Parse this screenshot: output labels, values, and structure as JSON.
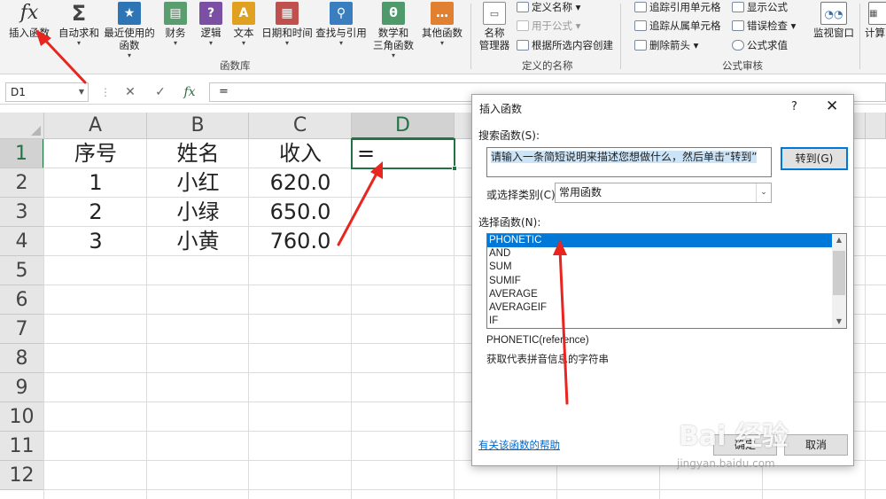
{
  "ribbon": {
    "insert_function": {
      "icon": "fx",
      "label": "插入函数"
    },
    "function_buttons": [
      {
        "id": "autosum",
        "label1": "自动求和",
        "label2": "",
        "icon": "sigma-icon",
        "color": "#555555",
        "glyph": "Σ"
      },
      {
        "id": "recent",
        "label1": "最近使用的",
        "label2": "函数",
        "icon": "star-icon",
        "color": "#2e75b6",
        "glyph": "★"
      },
      {
        "id": "financial",
        "label1": "财务",
        "label2": "",
        "icon": "book-icon",
        "color": "#5a9e6f",
        "glyph": "▤"
      },
      {
        "id": "logical",
        "label1": "逻辑",
        "label2": "",
        "icon": "question-icon",
        "color": "#7b4fa3",
        "glyph": "?"
      },
      {
        "id": "text",
        "label1": "文本",
        "label2": "",
        "icon": "text-a-icon",
        "color": "#e0a020",
        "glyph": "A"
      },
      {
        "id": "datetime",
        "label1": "日期和时间",
        "label2": "",
        "icon": "calendar-icon",
        "color": "#c0504d",
        "glyph": "▦"
      },
      {
        "id": "lookup",
        "label1": "查找与引用",
        "label2": "",
        "icon": "search-book-icon",
        "color": "#3a7ebf",
        "glyph": "⚲"
      },
      {
        "id": "math",
        "label1": "数学和",
        "label2": "三角函数",
        "icon": "theta-icon",
        "color": "#4f9a6a",
        "glyph": "θ"
      },
      {
        "id": "more",
        "label1": "其他函数",
        "label2": "",
        "icon": "more-icon",
        "color": "#e08030",
        "glyph": "…"
      }
    ],
    "group_function_library": "函数库",
    "name_manager": {
      "label1": "名称",
      "label2": "管理器"
    },
    "defined_names": {
      "define": "定义名称",
      "use_in_formula": "用于公式",
      "create_from_selection": "根据所选内容创建"
    },
    "group_defined_names": "定义的名称",
    "auditing": {
      "trace_precedents": "追踪引用单元格",
      "trace_dependents": "追踪从属单元格",
      "remove_arrows": "删除箭头",
      "show_formulas": "显示公式",
      "error_checking": "错误检查",
      "evaluate_formula": "公式求值"
    },
    "group_auditing": "公式审核",
    "watch_window": "监视窗口",
    "calculation": "计算"
  },
  "formula_bar": {
    "name_box": "D1",
    "fx": "fx",
    "formula": "="
  },
  "sheet": {
    "columns": [
      "A",
      "B",
      "C",
      "D"
    ],
    "rows": [
      "1",
      "2",
      "3",
      "4",
      "5",
      "6",
      "7",
      "8",
      "9",
      "10",
      "11",
      "12"
    ],
    "selected_column": "D",
    "selected_row": "1",
    "cells": [
      [
        "序号",
        "姓名",
        "收入",
        "="
      ],
      [
        "1",
        "小红",
        "620.0",
        ""
      ],
      [
        "2",
        "小绿",
        "650.0",
        ""
      ],
      [
        "3",
        "小黄",
        "760.0",
        ""
      ]
    ]
  },
  "dialog": {
    "title": "插入函数",
    "help": "?",
    "close": "✕",
    "search_label": "搜索函数(S):",
    "search_text": "请输入一条简短说明来描述您想做什么，然后单击“转到”",
    "go_button": "转到(G)",
    "category_label": "或选择类别(C):",
    "category_value": "常用函数",
    "select_label": "选择函数(N):",
    "functions": [
      "PHONETIC",
      "AND",
      "SUM",
      "SUMIF",
      "AVERAGE",
      "AVERAGEIF",
      "IF"
    ],
    "selected_function": "PHONETIC",
    "signature": "PHONETIC(reference)",
    "description": "获取代表拼音信息的字符串",
    "help_link": "有关该函数的帮助",
    "ok_button": "确定",
    "cancel_button": "取消"
  },
  "watermark": {
    "text": "Bai 经验",
    "url": "jingyan.baidu.com"
  },
  "colors": {
    "accent": "#217346",
    "annotation_arrow": "#e8251f",
    "selection_blue": "#0078d7"
  }
}
